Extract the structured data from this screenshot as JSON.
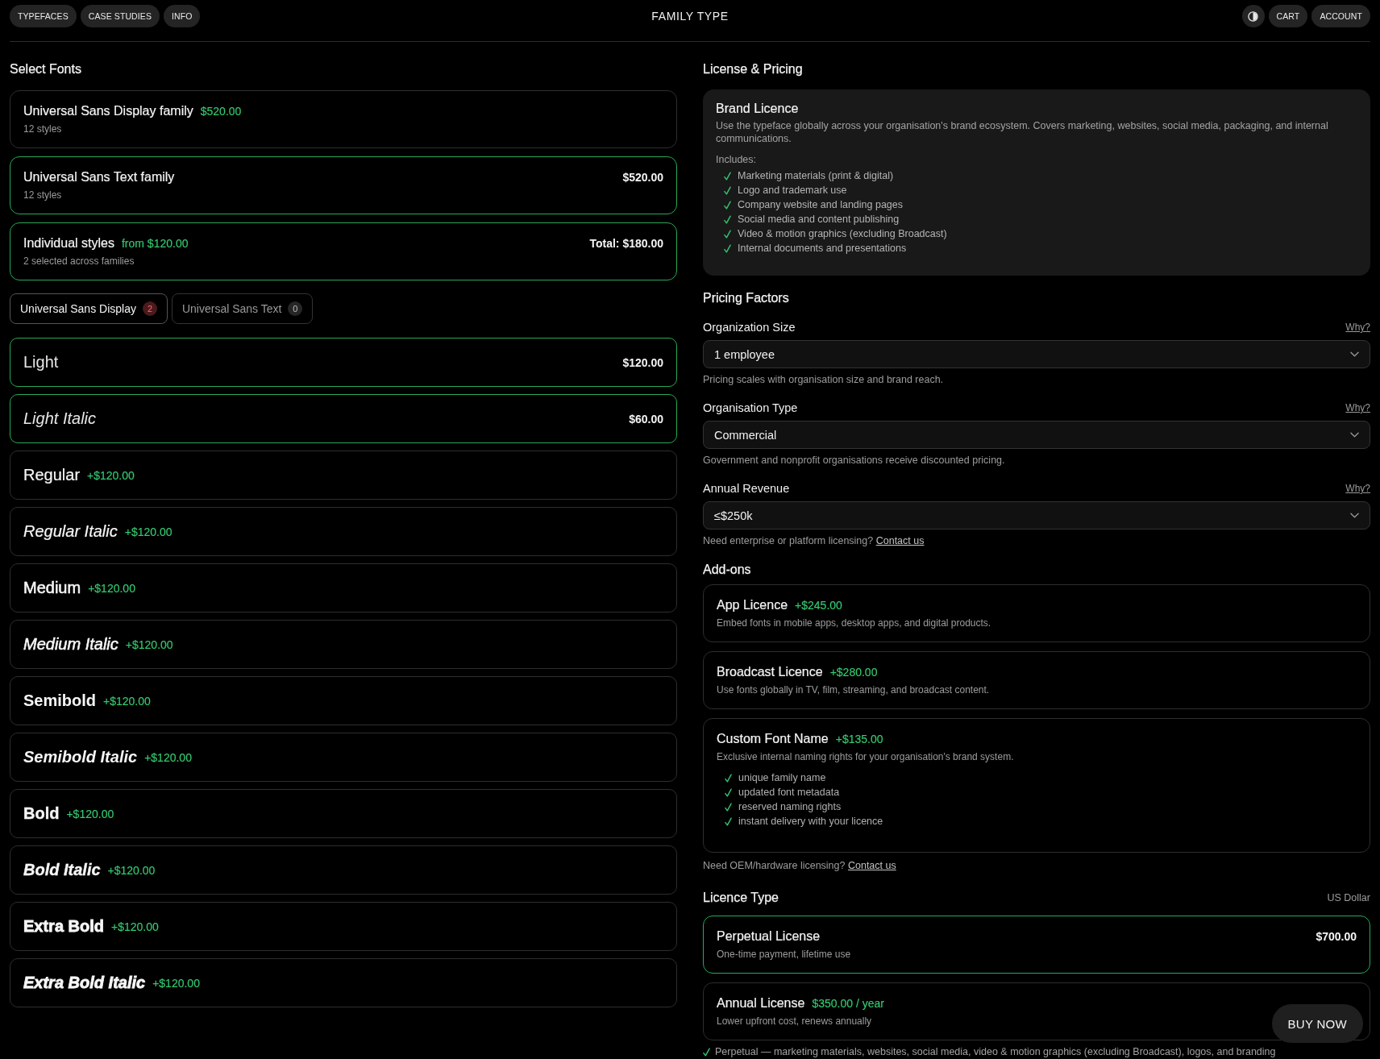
{
  "header": {
    "nav_links": [
      "TYPEFACES",
      "CASE STUDIES",
      "INFO"
    ],
    "title": "FAMILY TYPE",
    "actions": [
      "CART",
      "ACCOUNT"
    ]
  },
  "select_fonts": {
    "heading": "Select Fonts",
    "options": [
      {
        "name": "Universal Sans Display family",
        "inline_price": "$520.00",
        "subtitle": "12 styles",
        "selected": false
      },
      {
        "name": "Universal Sans Text family",
        "side_price": "$520.00",
        "subtitle": "12 styles",
        "selected": true
      },
      {
        "name": "Individual styles",
        "inline_price": "from $120.00",
        "side_price": "Total: $180.00",
        "subtitle": "2 selected across families",
        "selected": true
      }
    ],
    "family_tabs": [
      {
        "label": "Universal Sans Display",
        "count": "2",
        "selected": true
      },
      {
        "label": "Universal Sans Text",
        "count": "0",
        "selected": false
      }
    ],
    "styles": [
      {
        "name": "Light",
        "kind": "light",
        "italic": false,
        "price": "$120.00",
        "selected": true
      },
      {
        "name": "Light Italic",
        "kind": "light",
        "italic": true,
        "price": "$60.00",
        "selected": true
      },
      {
        "name": "Regular",
        "kind": "regular",
        "italic": false,
        "price": "+$120.00",
        "selected": false
      },
      {
        "name": "Regular Italic",
        "kind": "regular",
        "italic": true,
        "price": "+$120.00",
        "selected": false
      },
      {
        "name": "Medium",
        "kind": "medium",
        "italic": false,
        "price": "+$120.00",
        "selected": false
      },
      {
        "name": "Medium Italic",
        "kind": "medium",
        "italic": true,
        "price": "+$120.00",
        "selected": false
      },
      {
        "name": "Semibold",
        "kind": "semibold",
        "italic": false,
        "price": "+$120.00",
        "selected": false
      },
      {
        "name": "Semibold Italic",
        "kind": "semibold",
        "italic": true,
        "price": "+$120.00",
        "selected": false
      },
      {
        "name": "Bold",
        "kind": "bold",
        "italic": false,
        "price": "+$120.00",
        "selected": false
      },
      {
        "name": "Bold Italic",
        "kind": "bold",
        "italic": true,
        "price": "+$120.00",
        "selected": false
      },
      {
        "name": "Extra Bold",
        "kind": "extrabold",
        "italic": false,
        "price": "+$120.00",
        "selected": false
      },
      {
        "name": "Extra Bold Italic",
        "kind": "extrabold",
        "italic": true,
        "price": "+$120.00",
        "selected": false
      }
    ]
  },
  "license_pricing": {
    "heading": "License & Pricing",
    "brand_licence": {
      "title": "Brand Licence",
      "description": "Use the typeface globally across your organisation's brand ecosystem. Covers marketing, websites, social media, packaging, and internal communications.",
      "includes_label": "Includes:",
      "includes": [
        "Marketing materials (print & digital)",
        "Logo and trademark use",
        "Company website and landing pages",
        "Social media and content publishing",
        "Video & motion graphics (excluding Broadcast)",
        "Internal documents and presentations"
      ]
    }
  },
  "pricing_factors": {
    "heading": "Pricing Factors",
    "fields": [
      {
        "label": "Organization Size",
        "link": "Why?",
        "value": "1 employee",
        "hint": "Pricing scales with organisation size and brand reach."
      },
      {
        "label": "Organisation Type",
        "link": "Why?",
        "value": "Commercial",
        "hint": "Government and nonprofit organisations receive discounted pricing."
      },
      {
        "label": "Annual Revenue",
        "link": "Why?",
        "value": "≤$250k",
        "hint": "Need enterprise or platform licensing?",
        "hint_link": "Contact us"
      }
    ]
  },
  "addons": {
    "heading": "Add-ons",
    "items": [
      {
        "name": "App Licence",
        "price": "+$245.00",
        "description": "Embed fonts in mobile apps, desktop apps, and digital products.",
        "selected": false
      },
      {
        "name": "Broadcast Licence",
        "price": "+$280.00",
        "description": "Use fonts globally in TV, film, streaming, and broadcast content.",
        "selected": false
      },
      {
        "name": "Custom Font Name",
        "price": "+$135.00",
        "description": "Exclusive internal naming rights for your organisation's brand system.",
        "features": [
          "unique family name",
          "updated font metadata",
          "reserved naming rights",
          "instant delivery with your licence"
        ],
        "selected": false
      }
    ],
    "footer": "Need OEM/hardware licensing?",
    "footer_link": "Contact us"
  },
  "licence_type": {
    "heading": "Licence Type",
    "currency": "US Dollar",
    "options": [
      {
        "name": "Perpetual License",
        "price": "$700.00",
        "description": "One-time payment, lifetime use",
        "selected": true
      },
      {
        "name": "Annual License",
        "price": "$350.00 / year",
        "description": "Lower upfront cost, renews annually",
        "selected": false
      }
    ],
    "note": "Perpetual — marketing materials, websites, social media, video & motion graphics (excluding Broadcast), logos, and branding"
  },
  "buy_button": "BUY NOW"
}
